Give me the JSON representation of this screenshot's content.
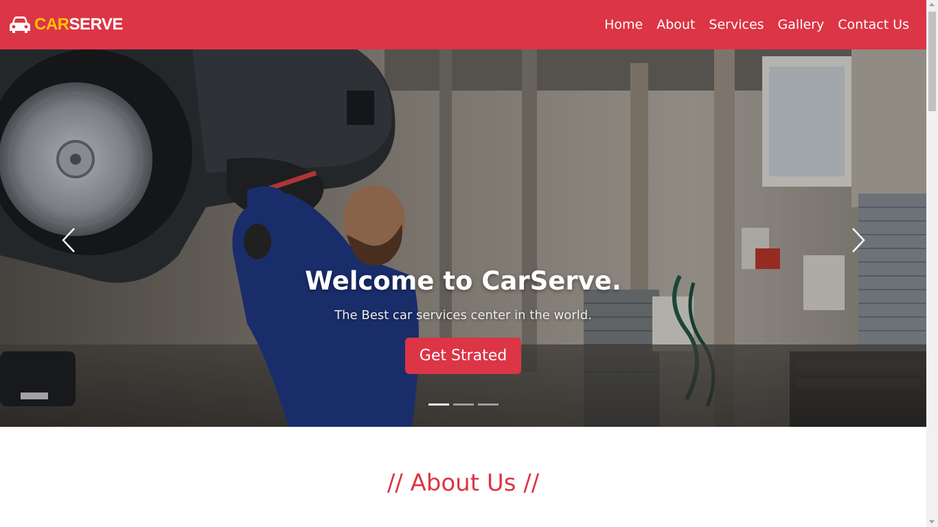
{
  "brand": {
    "part1": "CAR",
    "part2": "SERVE",
    "icon": "car-icon"
  },
  "nav": {
    "items": [
      {
        "label": "Home"
      },
      {
        "label": "About"
      },
      {
        "label": "Services"
      },
      {
        "label": "Gallery"
      },
      {
        "label": "Contact Us"
      }
    ]
  },
  "hero": {
    "title": "Welcome to CarServe.",
    "subtitle": "The Best car services center in the world.",
    "button_label": "Get Strated",
    "prev_icon": "chevron-left-icon",
    "next_icon": "chevron-right-icon",
    "slide_count": 3,
    "active_slide": 1
  },
  "about": {
    "title": "// About Us //"
  },
  "colors": {
    "primary": "#dc3545",
    "brand_accent": "#ffc107",
    "nav_text": "#ffffff"
  }
}
